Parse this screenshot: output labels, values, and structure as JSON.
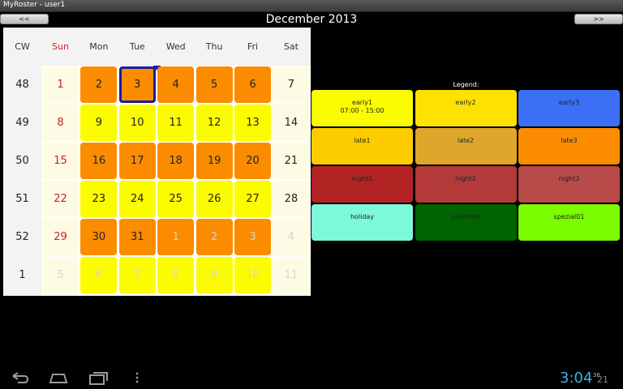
{
  "window": {
    "title": "MyRoster - user1"
  },
  "nav": {
    "prev_label": "<<",
    "next_label": ">>",
    "month_title": "December 2013"
  },
  "calendar": {
    "headers": [
      "CW",
      "Sun",
      "Mon",
      "Tue",
      "Wed",
      "Thu",
      "Fri",
      "Sat"
    ],
    "weeks": [
      {
        "cw": "48",
        "days": [
          {
            "n": "1",
            "style": "plain"
          },
          {
            "n": "2",
            "style": "orange"
          },
          {
            "n": "3",
            "style": "orange",
            "selected": true
          },
          {
            "n": "4",
            "style": "orange"
          },
          {
            "n": "5",
            "style": "orange"
          },
          {
            "n": "6",
            "style": "orange"
          },
          {
            "n": "7",
            "style": "plain"
          }
        ]
      },
      {
        "cw": "49",
        "days": [
          {
            "n": "8",
            "style": "plain"
          },
          {
            "n": "9",
            "style": "yellow"
          },
          {
            "n": "10",
            "style": "yellow"
          },
          {
            "n": "11",
            "style": "yellow"
          },
          {
            "n": "12",
            "style": "yellow"
          },
          {
            "n": "13",
            "style": "yellow"
          },
          {
            "n": "14",
            "style": "plain"
          }
        ]
      },
      {
        "cw": "50",
        "days": [
          {
            "n": "15",
            "style": "plain"
          },
          {
            "n": "16",
            "style": "orange"
          },
          {
            "n": "17",
            "style": "orange"
          },
          {
            "n": "18",
            "style": "orange"
          },
          {
            "n": "19",
            "style": "orange"
          },
          {
            "n": "20",
            "style": "orange"
          },
          {
            "n": "21",
            "style": "plain"
          }
        ]
      },
      {
        "cw": "51",
        "days": [
          {
            "n": "22",
            "style": "plain"
          },
          {
            "n": "23",
            "style": "yellow"
          },
          {
            "n": "24",
            "style": "yellow"
          },
          {
            "n": "25",
            "style": "yellow"
          },
          {
            "n": "26",
            "style": "yellow"
          },
          {
            "n": "27",
            "style": "yellow"
          },
          {
            "n": "28",
            "style": "plain"
          }
        ]
      },
      {
        "cw": "52",
        "days": [
          {
            "n": "29",
            "style": "plain"
          },
          {
            "n": "30",
            "style": "orange"
          },
          {
            "n": "31",
            "style": "orange"
          },
          {
            "n": "1",
            "style": "orange",
            "other": true
          },
          {
            "n": "2",
            "style": "orange",
            "other": true
          },
          {
            "n": "3",
            "style": "orange",
            "other": true
          },
          {
            "n": "4",
            "style": "plain",
            "other": true
          }
        ]
      },
      {
        "cw": "1",
        "days": [
          {
            "n": "5",
            "style": "plain",
            "other": true
          },
          {
            "n": "6",
            "style": "yellow",
            "other": true
          },
          {
            "n": "7",
            "style": "yellow",
            "other": true
          },
          {
            "n": "8",
            "style": "yellow",
            "other": true
          },
          {
            "n": "9",
            "style": "yellow",
            "other": true
          },
          {
            "n": "10",
            "style": "yellow",
            "other": true
          },
          {
            "n": "11",
            "style": "plain",
            "other": true
          }
        ]
      }
    ]
  },
  "legend": {
    "title": "Legend:",
    "items": [
      {
        "label": "early1",
        "sub": "07:00 - 15:00",
        "color": "#fcfc00",
        "text": "#222222"
      },
      {
        "label": "early2",
        "sub": "",
        "color": "#fde200",
        "text": "#222222"
      },
      {
        "label": "early3",
        "sub": "",
        "color": "#3b6ff5",
        "text": "#222222"
      },
      {
        "label": "late1",
        "sub": "",
        "color": "#fdcc00",
        "text": "#222222"
      },
      {
        "label": "late2",
        "sub": "",
        "color": "#dfa62c",
        "text": "#222222"
      },
      {
        "label": "late3",
        "sub": "",
        "color": "#fb8c00",
        "text": "#222222"
      },
      {
        "label": "night1",
        "sub": "",
        "color": "#b22323",
        "text": "#222222"
      },
      {
        "label": "night2",
        "sub": "",
        "color": "#b43a3a",
        "text": "#222222"
      },
      {
        "label": "night3",
        "sub": "",
        "color": "#b84a4a",
        "text": "#222222"
      },
      {
        "label": "holiday",
        "sub": "",
        "color": "#7cf9d8",
        "text": "#222222"
      },
      {
        "label": "overtime",
        "sub": "",
        "color": "#006400",
        "text": "#222222"
      },
      {
        "label": "spezial01",
        "sub": "",
        "color": "#7cfc00",
        "text": "#222222"
      }
    ]
  },
  "statusbar": {
    "time": "3:04",
    "signal": "36",
    "icons": "21"
  },
  "icons": {
    "back": "back-icon",
    "home": "home-icon",
    "recents": "recent-apps-icon",
    "menu": "menu-icon"
  }
}
